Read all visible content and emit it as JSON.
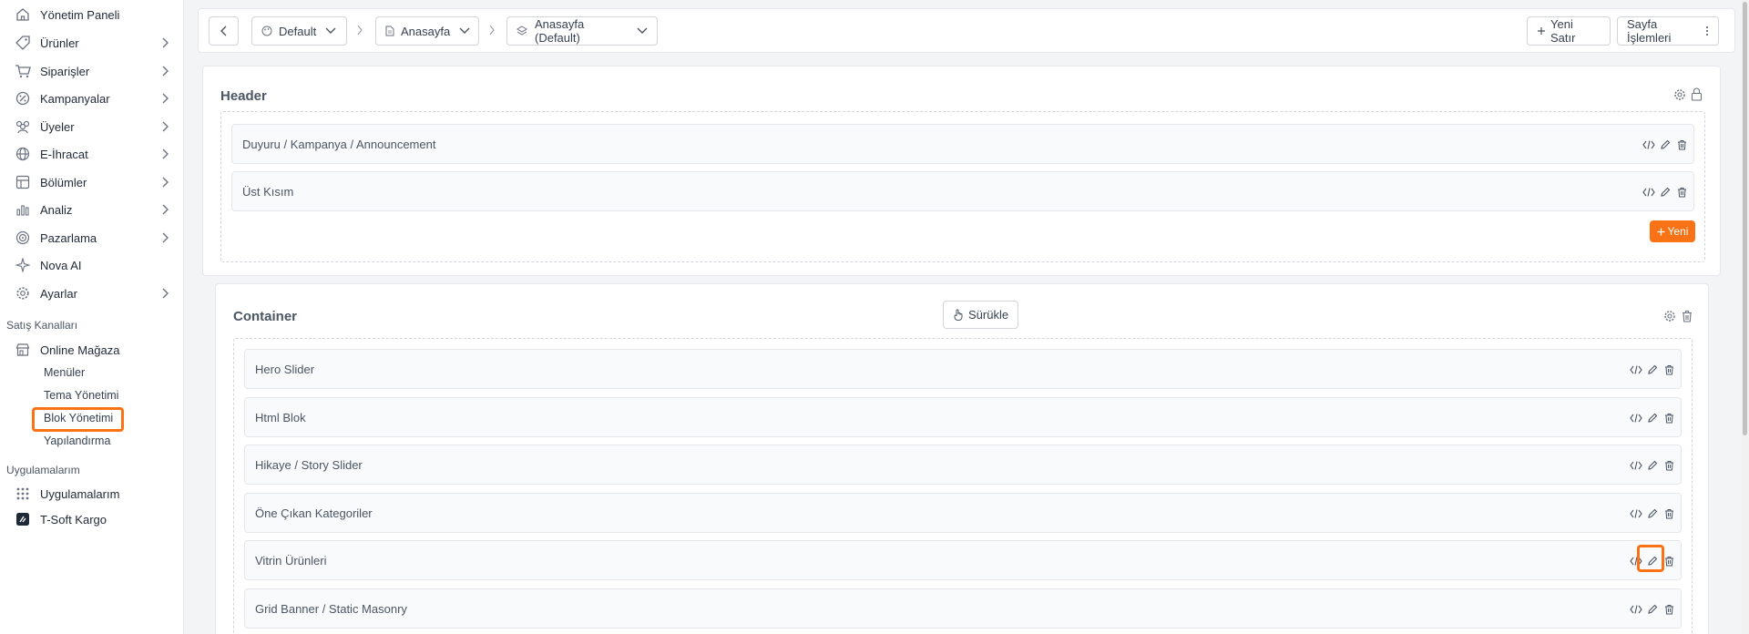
{
  "sidebar": {
    "items": [
      {
        "label": "Yönetim Paneli",
        "icon": "home-icon",
        "chevron": false
      },
      {
        "label": "Ürünler",
        "icon": "tag-icon",
        "chevron": true
      },
      {
        "label": "Siparişler",
        "icon": "cart-icon",
        "chevron": true
      },
      {
        "label": "Kampanyalar",
        "icon": "discount-icon",
        "chevron": true
      },
      {
        "label": "Üyeler",
        "icon": "users-icon",
        "chevron": true
      },
      {
        "label": "E-İhracat",
        "icon": "globe-icon",
        "chevron": true
      },
      {
        "label": "Bölümler",
        "icon": "sections-icon",
        "chevron": true
      },
      {
        "label": "Analiz",
        "icon": "chart-icon",
        "chevron": true
      },
      {
        "label": "Pazarlama",
        "icon": "target-icon",
        "chevron": true
      },
      {
        "label": "Nova AI",
        "icon": "sparkle-icon",
        "chevron": false
      },
      {
        "label": "Ayarlar",
        "icon": "gear-icon",
        "chevron": true
      }
    ],
    "sales_channels_label": "Satış Kanalları",
    "online_store_label": "Online Mağaza",
    "sub_items": [
      "Menüler",
      "Tema Yönetimi",
      "Blok Yönetimi",
      "Yapılandırma"
    ],
    "apps_section_label": "Uygulamalarım",
    "apps_item_label": "Uygulamalarım",
    "tsoft_label": "T-Soft Kargo"
  },
  "topbar": {
    "theme_label": "Default",
    "page_label": "Anasayfa",
    "variant_label": "Anasayfa (Default)",
    "new_row_label": "Yeni Satır",
    "page_actions_label": "Sayfa İşlemleri"
  },
  "header_panel": {
    "title": "Header",
    "rows": [
      "Duyuru / Kampanya / Announcement",
      "Üst Kısım"
    ],
    "new_button_label": "Yeni"
  },
  "container_panel": {
    "title": "Container",
    "drag_label": "Sürükle",
    "rows": [
      "Hero Slider",
      "Html Blok",
      "Hikaye / Story Slider",
      "Öne Çıkan Kategoriler",
      "Vitrin Ürünleri",
      "Grid Banner / Static Masonry"
    ]
  },
  "colors": {
    "accent": "#f97316",
    "sidebar_bg": "#ffffff",
    "page_bg": "#f3f4f6"
  }
}
